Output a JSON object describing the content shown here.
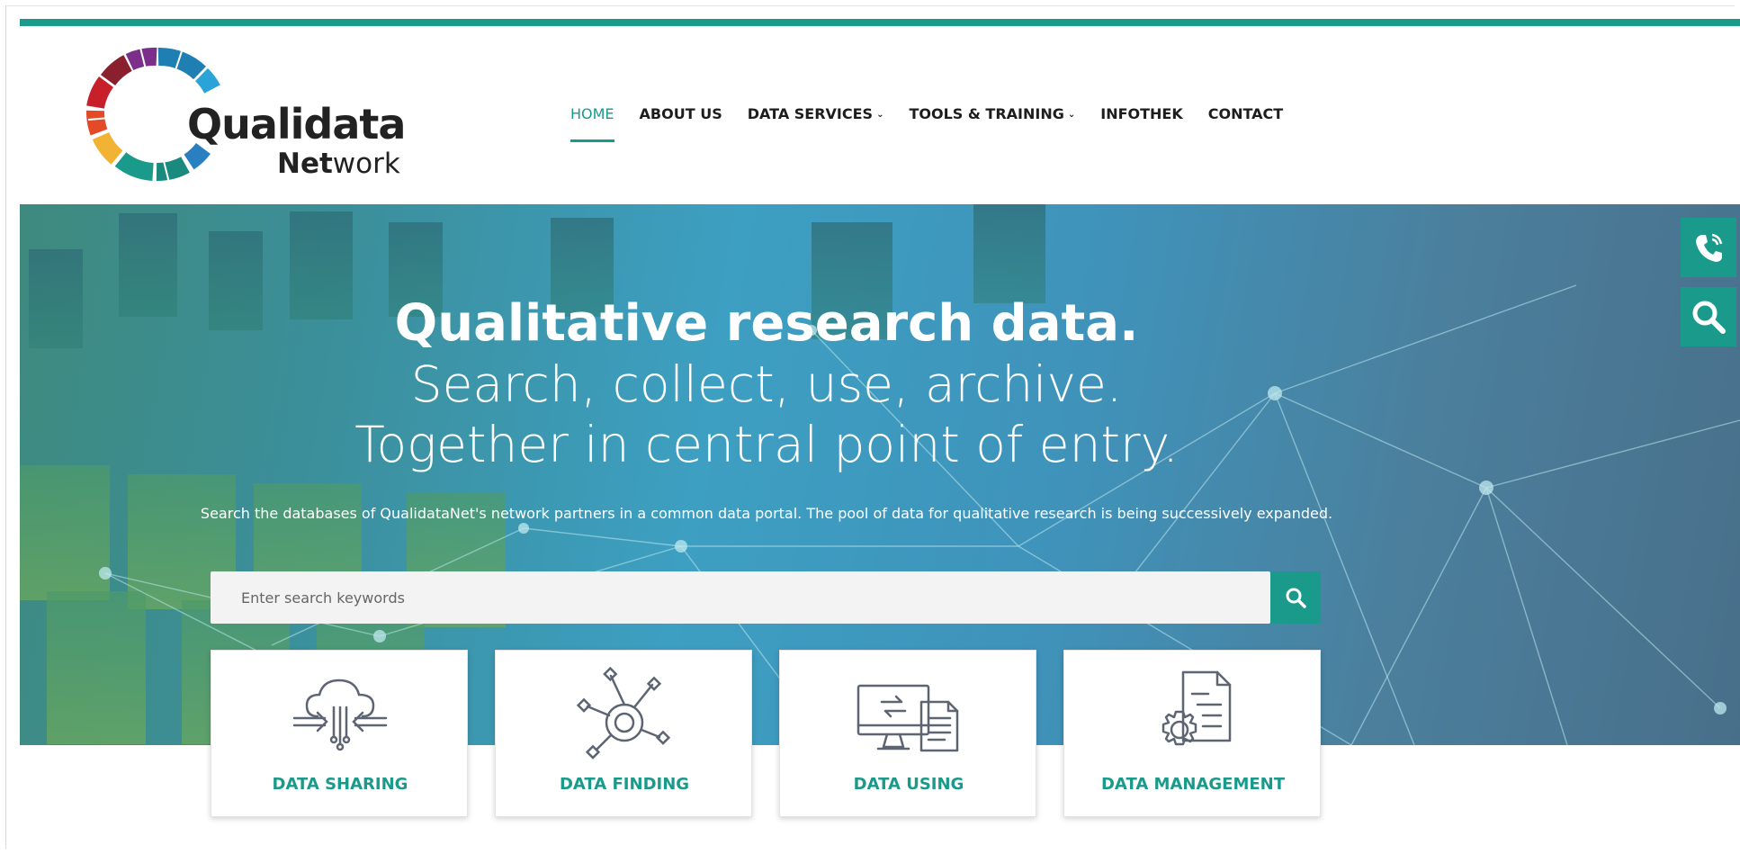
{
  "brand": {
    "logo_title": "Qualidata",
    "logo_sub_bold": "Net",
    "logo_sub_rest": "work",
    "accent_color": "#1a9a8b"
  },
  "nav": {
    "items": [
      {
        "label": "HOME",
        "active": true
      },
      {
        "label": "ABOUT US"
      },
      {
        "label": "DATA SERVICES",
        "caret": "⌄"
      },
      {
        "label": "TOOLS & TRAINING",
        "caret": "⌄"
      },
      {
        "label": "INFOTHEK"
      },
      {
        "label": "CONTACT"
      }
    ]
  },
  "hero": {
    "title": "Qualitative research data.",
    "line1": "Search, collect, use, archive.",
    "line2": "Together in central point of entry.",
    "description": "Search the databases of QualidataNet's network partners in a common data portal. The pool of data for qualitative research is being successively expanded."
  },
  "search": {
    "placeholder": "Enter search keywords",
    "value": "",
    "button_icon": "search-icon"
  },
  "side_buttons": {
    "phone_icon": "phone-icon",
    "search_icon": "search-icon"
  },
  "cards": [
    {
      "label": "DATA SHARING",
      "icon": "cloud-share-icon"
    },
    {
      "label": "DATA FINDING",
      "icon": "network-target-icon"
    },
    {
      "label": "DATA USING",
      "icon": "monitor-document-icon"
    },
    {
      "label": "DATA MANAGEMENT",
      "icon": "document-gear-icon"
    }
  ]
}
